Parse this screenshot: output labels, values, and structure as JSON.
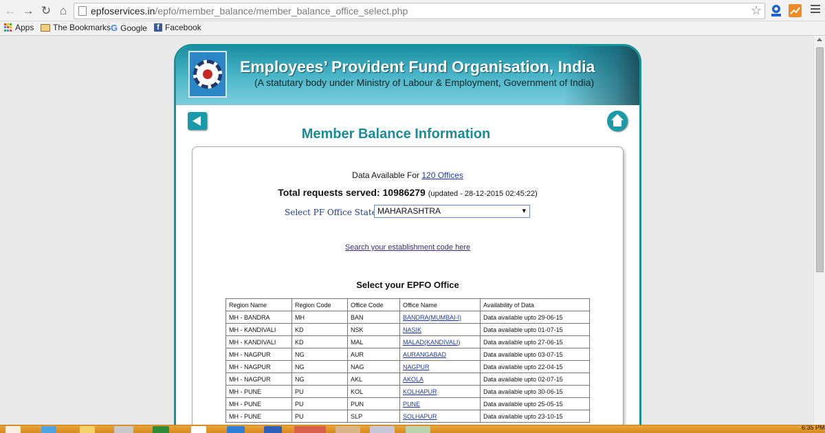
{
  "browser": {
    "url_host": "epfoservices.in",
    "url_path": "/epfo/member_balance/member_balance_office_select.php"
  },
  "bookmarks": [
    {
      "label": "Apps"
    },
    {
      "label": "The Bookmarks"
    },
    {
      "label": "Google"
    },
    {
      "label": "Facebook"
    }
  ],
  "banner": {
    "title": "Employees’ Provident Fund Organisation, India",
    "subtitle": "(A statutary body under Ministry of Labour & Employment, Government of India)"
  },
  "page": {
    "heading": "Member Balance Information",
    "data_available_prefix": "Data Available For",
    "offices_link": "120 Offices",
    "total_requests": "Total requests served: 10986279",
    "updated": "(updated - 28-12-2015 02:45:22)",
    "state_label": "Select PF Office State",
    "state_selected": "MAHARASHTRA",
    "establishment_link": "Search your establishment code here",
    "select_office_heading": "Select your EPFO Office"
  },
  "table": {
    "headers": [
      "Region Name",
      "Region Code",
      "Office Code",
      "Office Name",
      "Availability of Data"
    ],
    "rows": [
      {
        "region_name": "MH - BANDRA",
        "region_code": "MH",
        "office_code": "BAN",
        "office_name": "BANDRA(MUMBAI-I)",
        "availability": "Data available upto 29-06-15"
      },
      {
        "region_name": "MH - KANDIVALI",
        "region_code": "KD",
        "office_code": "NSK",
        "office_name": "NASIK",
        "availability": "Data available upto 01-07-15"
      },
      {
        "region_name": "MH - KANDIVALI",
        "region_code": "KD",
        "office_code": "MAL",
        "office_name": "MALAD(KANDIVALI)",
        "availability": "Data available upto 27-06-15"
      },
      {
        "region_name": "MH - NAGPUR",
        "region_code": "NG",
        "office_code": "AUR",
        "office_name": "AURANGABAD",
        "availability": "Data available upto 03-07-15"
      },
      {
        "region_name": "MH - NAGPUR",
        "region_code": "NG",
        "office_code": "NAG",
        "office_name": "NAGPUR",
        "availability": "Data available upto 22-04-15"
      },
      {
        "region_name": "MH - NAGPUR",
        "region_code": "NG",
        "office_code": "AKL",
        "office_name": "AKOLA",
        "availability": "Data available upto 02-07-15"
      },
      {
        "region_name": "MH - PUNE",
        "region_code": "PU",
        "office_code": "KOL",
        "office_name": "KOLHAPUR",
        "availability": "Data available upto 30-06-15"
      },
      {
        "region_name": "MH - PUNE",
        "region_code": "PU",
        "office_code": "PUN",
        "office_name": "PUNE",
        "availability": "Data available upto 25-05-15"
      },
      {
        "region_name": "MH - PUNE",
        "region_code": "PU",
        "office_code": "SLP",
        "office_name": "SOLHAPUR",
        "availability": "Data available upto 23-10-15"
      }
    ]
  },
  "taskbar": {
    "clock": "6:35 PM"
  },
  "colors": {
    "accent_teal": "#1b8b98",
    "link_blue": "#1c3aa6",
    "taskbar_orange": "#e9a53a"
  },
  "icons": [
    "back-arrow-icon",
    "forward-arrow-icon",
    "reload-icon",
    "home-icon",
    "page-icon",
    "star-icon",
    "menu-icon",
    "apps-icon",
    "folder-icon",
    "google-icon",
    "facebook-icon",
    "epfo-logo",
    "back-icon",
    "home-button-icon"
  ]
}
